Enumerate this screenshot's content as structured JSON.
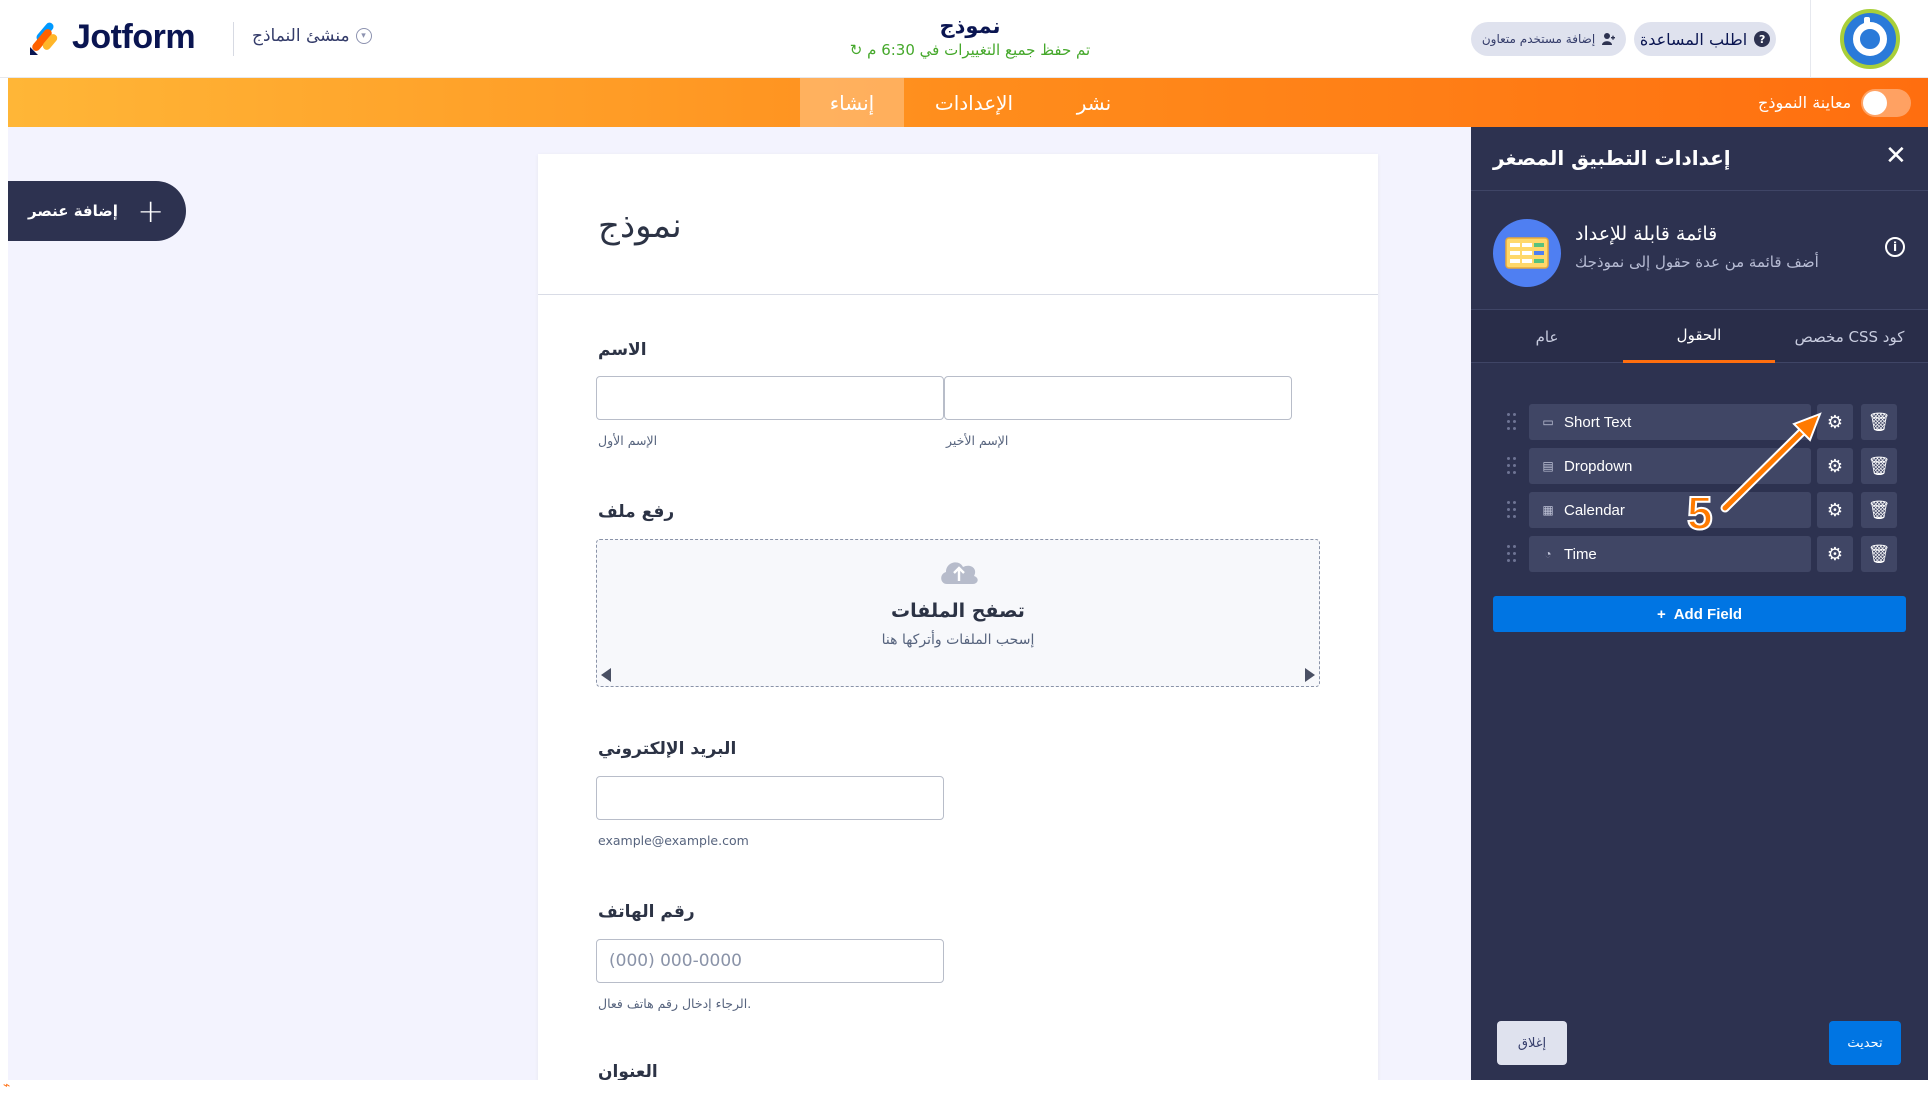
{
  "app": {
    "logo_text": "Jotform",
    "builder_menu": "منشئ النماذج",
    "form_title": "نموذج",
    "saved_status": "تم حفظ جميع التغييرات في 6:30 م",
    "add_collaborator": "إضافة مستخدم متعاون",
    "help": "اطلب المساعدة"
  },
  "nav": {
    "tabs": [
      {
        "label": "إنشاء",
        "active": true
      },
      {
        "label": "الإعدادات",
        "active": false
      },
      {
        "label": "نشر",
        "active": false
      }
    ],
    "preview_label": "معاينة النموذج"
  },
  "workspace": {
    "add_element": "إضافة عنصر"
  },
  "form": {
    "title": "نموذج",
    "name_label": "الاسم",
    "first_name_sub": "الإسم الأول",
    "last_name_sub": "الإسم الأخير",
    "upload_label": "رفع ملف",
    "upload_title": "تصفح الملفات",
    "upload_sub": "إسحب الملفات وأتركها هنا",
    "email_label": "البريد الإلكتروني",
    "email_sub": "example@example.com",
    "phone_label": "رقم الهاتف",
    "phone_placeholder": "(000) 000-0000",
    "phone_sub": "الرجاء إدخال رقم هاتف فعال.",
    "address_label": "العنوان"
  },
  "panel": {
    "title": "إعدادات التطبيق المصغر",
    "widget_name": "قائمة قابلة للإعداد",
    "widget_desc": "أضف قائمة من عدة حقول إلى نموذجك",
    "tabs": [
      {
        "label": "مخصص CSS كود",
        "active": false
      },
      {
        "label": "الحقول",
        "active": true
      },
      {
        "label": "عام",
        "active": false
      }
    ],
    "fields": [
      {
        "label": "Short Text",
        "icon": "short-text-icon"
      },
      {
        "label": "Dropdown",
        "icon": "dropdown-icon"
      },
      {
        "label": "Calendar",
        "icon": "calendar-icon"
      },
      {
        "label": "Time",
        "icon": "clock-icon"
      }
    ],
    "add_field": "Add Field",
    "close_button": "إغلاق",
    "update_button": "تحديث"
  },
  "annotation": {
    "step_number": "5"
  },
  "colors": {
    "brand_navy": "#0a1551",
    "orange_start": "#ffb637",
    "orange_end": "#ff6e0f",
    "panel_bg": "#2d3250",
    "primary_blue": "#0075e3",
    "saved_green": "#45a82b"
  }
}
